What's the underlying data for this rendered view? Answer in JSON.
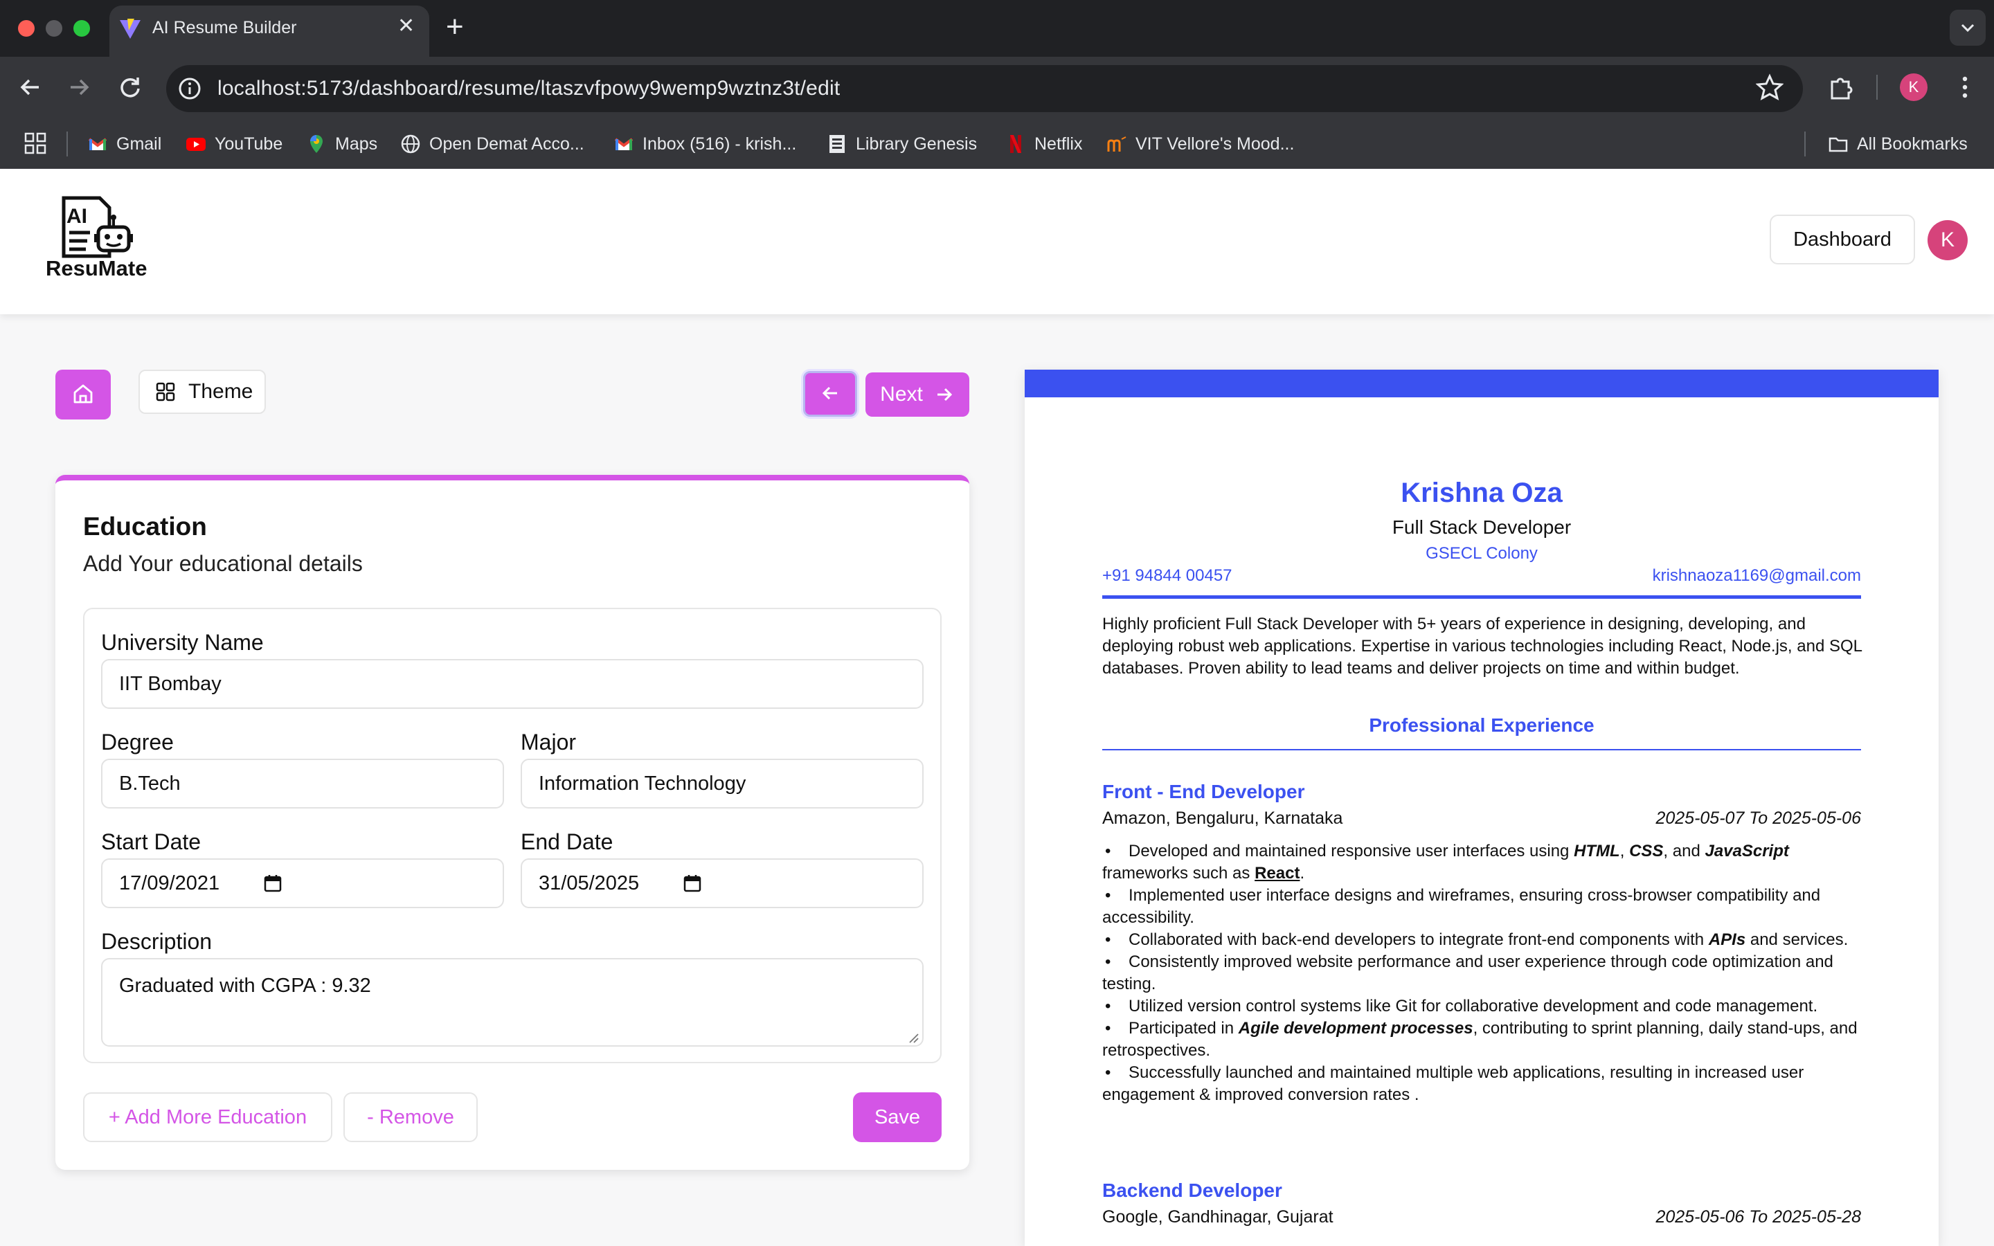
{
  "browser": {
    "tab_title": "AI Resume Builder",
    "url": "localhost:5173/dashboard/resume/ltaszvfpowy9wemp9wztnz3t/edit",
    "profile_initial": "K",
    "bookmarks": [
      {
        "label": "Gmail",
        "icon": "gmail-icon"
      },
      {
        "label": "YouTube",
        "icon": "youtube-icon"
      },
      {
        "label": "Maps",
        "icon": "maps-icon"
      },
      {
        "label": "Open Demat Acco...",
        "icon": "globe-icon"
      },
      {
        "label": "Inbox (516) - krish...",
        "icon": "gmail-icon"
      },
      {
        "label": "Library Genesis",
        "icon": "book-icon"
      },
      {
        "label": "Netflix",
        "icon": "netflix-icon"
      },
      {
        "label": "VIT Vellore's Mood...",
        "icon": "moodle-icon"
      }
    ],
    "all_bookmarks": "All Bookmarks"
  },
  "app": {
    "logo_text": "ResuMate",
    "logo_mark": "AI",
    "dashboard_label": "Dashboard",
    "avatar_initial": "K",
    "accent": "#d455e6",
    "resume_color": "#3b51f0"
  },
  "controls": {
    "theme_label": "Theme",
    "next_label": "Next"
  },
  "education": {
    "title": "Education",
    "subtitle": "Add Your educational details",
    "university_label": "University Name",
    "university_value": "IIT Bombay",
    "degree_label": "Degree",
    "degree_value": "B.Tech",
    "major_label": "Major",
    "major_value": "Information Technology",
    "start_label": "Start Date",
    "start_value": "17/09/2021",
    "end_label": "End Date",
    "end_value": "31/05/2025",
    "description_label": "Description",
    "description_value": "Graduated with CGPA : 9.32",
    "add_more_label": "+ Add More Education",
    "remove_label": "- Remove",
    "save_label": "Save"
  },
  "resume": {
    "name": "Krishna Oza",
    "role": "Full Stack Developer",
    "address": "GSECL Colony",
    "phone": "+91 94844 00457",
    "email": "krishnaoza1169@gmail.com",
    "summary": "Highly proficient Full Stack Developer with 5+ years of experience in designing, developing, and deploying robust web applications. Expertise in various technologies including React, Node.js, and SQL databases. Proven ability to lead teams and deliver projects on time and within budget.",
    "experience_heading": "Professional Experience",
    "jobs": [
      {
        "title": "Front - End Developer",
        "company": "Amazon, Bengaluru, Karnataka",
        "dates": "2025-05-07 To 2025-05-06",
        "bullets": [
          "Developed and maintained responsive user interfaces using HTML, CSS, and JavaScript frameworks such as React.",
          "Implemented user interface designs and wireframes, ensuring cross-browser compatibility and accessibility.",
          "Collaborated with back-end developers to integrate front-end components with APIs and services.",
          "Consistently improved website performance and user experience through code optimization and testing.",
          "Utilized version control systems like Git for collaborative development and code management.",
          "Participated in Agile development processes, contributing to sprint planning, daily stand-ups, and retrospectives.",
          "Successfully launched and maintained multiple web applications, resulting in increased user engagement & improved conversion rates ."
        ]
      },
      {
        "title": "Backend Developer",
        "company": "Google, Gandhinagar, Gujarat",
        "dates": "2025-05-06 To 2025-05-28"
      }
    ]
  }
}
